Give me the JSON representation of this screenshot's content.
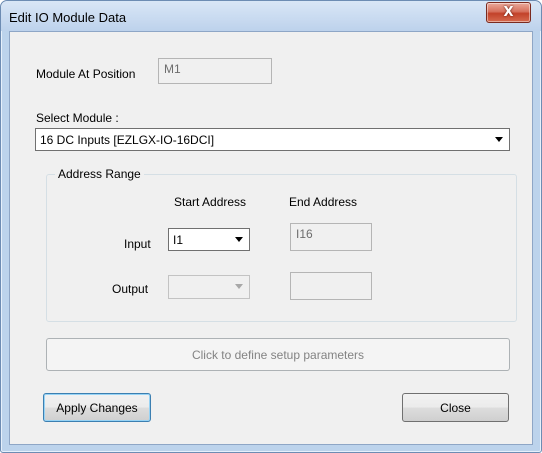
{
  "window": {
    "title": "Edit IO Module Data",
    "close_glyph": "X",
    "close_icon": "close-icon"
  },
  "module_position": {
    "label": "Module At Position",
    "value": "M1"
  },
  "select_module": {
    "label": "Select Module :",
    "value": "16 DC Inputs [EZLGX-IO-16DCI]"
  },
  "address_range": {
    "legend": "Address Range",
    "start_header": "Start Address",
    "end_header": "End Address",
    "input": {
      "label": "Input",
      "start_value": "I1",
      "end_value": "I16"
    },
    "output": {
      "label": "Output",
      "start_value": "",
      "end_value": ""
    }
  },
  "setup_button": {
    "label": "Click to define setup parameters"
  },
  "footer": {
    "apply_label": "Apply Changes",
    "close_label": "Close"
  },
  "colors": {
    "title_bar": "#bcd3ec",
    "close_button": "#c2422a",
    "client_bg": "#f0f0f0",
    "default_button_border": "#3c7fb1"
  }
}
